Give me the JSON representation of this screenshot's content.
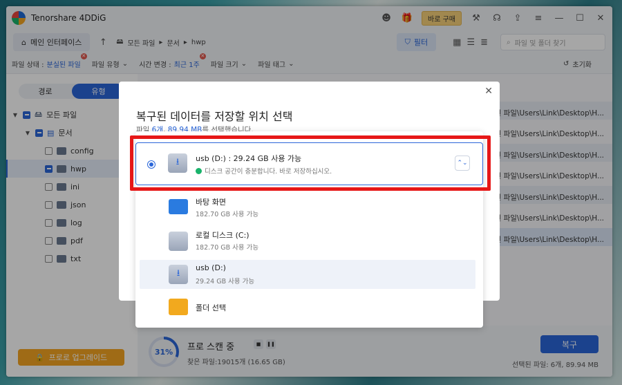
{
  "app": {
    "title": "Tenorshare 4DDiG",
    "buy_label": "바로 구매"
  },
  "toolbar": {
    "home_label": "메인 인터페이스",
    "breadcrumb": [
      "모든 파일",
      "문서",
      "hwp"
    ],
    "filter_label": "필터",
    "search_placeholder": "파일 및 폴더 찾기"
  },
  "filters": {
    "status_label": "파일 상태 :",
    "status_value": "분실된 파일",
    "type_label": "파일 유형",
    "time_label": "시간 변경 :",
    "time_value": "최근 1주",
    "size_label": "파일 크기",
    "tag_label": "파일 태그",
    "reset_label": "초기화"
  },
  "sidebar": {
    "tab_path": "경로",
    "tab_type": "유형",
    "tree": [
      {
        "label": "모든 파일",
        "level": 0
      },
      {
        "label": "문서",
        "level": 1
      },
      {
        "label": "config",
        "level": 2
      },
      {
        "label": "hwp",
        "level": 2
      },
      {
        "label": "ini",
        "level": 2
      },
      {
        "label": "json",
        "level": 2
      },
      {
        "label": "log",
        "level": 2
      },
      {
        "label": "pdf",
        "level": 2
      },
      {
        "label": "txt",
        "level": 2
      }
    ],
    "upgrade_label": "프로로 업그레이드"
  },
  "main": {
    "paths": [
      "된 파일\\Users\\Link\\Desktop\\H...",
      "된 파일\\Users\\Link\\Desktop\\H...",
      "된 파일\\Users\\Link\\Desktop\\H...",
      "된 파일\\Users\\Link\\Desktop\\H...",
      "된 파일\\Users\\Link\\Desktop\\H...",
      "된 파일\\Users\\Link\\Desktop\\H...",
      "된 파일\\Users\\Link\\Desktop\\H..."
    ]
  },
  "scan": {
    "percent": "31%",
    "title": "프로 스캔 중",
    "found": "찾은 파일:19015개 (16.65 GB)",
    "recover_label": "복구",
    "selected": "선택된 파일: 6개, 89.94 MB"
  },
  "dialog": {
    "title": "복구된 데이터를 저장할 위치 선택",
    "sub_prefix": "파일 ",
    "sub_count": "6개",
    "sub_sep": ", ",
    "sub_size": "89.94 MB",
    "sub_suffix": "를 선택했습니다.",
    "selected_drive": {
      "name": "usb (D:) : 29.24 GB 사용 가능",
      "note": "디스크 공간이 충분합니다. 바로 저장하십시오."
    },
    "options": [
      {
        "name": "바탕 화면",
        "sub": "182.70 GB 사용 가능",
        "icon": "desktop-icon"
      },
      {
        "name": "로컬 디스크 (C:)",
        "sub": "182.70 GB 사용 가능",
        "icon": "drive-icon"
      },
      {
        "name": "usb (D:)",
        "sub": "29.24 GB 사용 가능",
        "icon": "usb-icon"
      },
      {
        "name": "폴더 선택",
        "sub": "",
        "icon": "folder-icon"
      }
    ]
  }
}
